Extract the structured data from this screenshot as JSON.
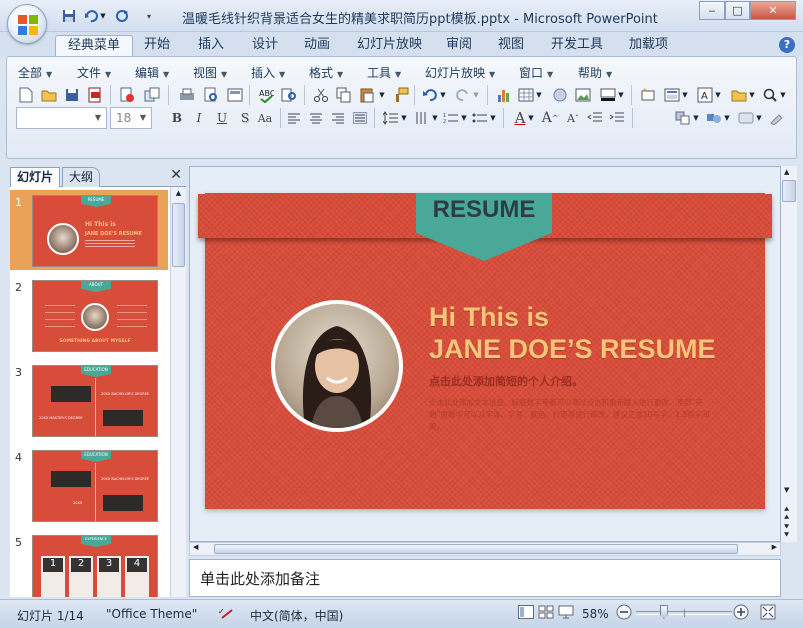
{
  "window": {
    "title": "温暖毛线针织背景适合女生的精美求职简历ppt模板.pptx - Microsoft PowerPoint",
    "minimize": "‒",
    "maximize": "□",
    "close": "✕"
  },
  "ribbon_tabs": [
    "经典菜单",
    "开始",
    "插入",
    "设计",
    "动画",
    "幻灯片放映",
    "审阅",
    "视图",
    "开发工具",
    "加载项"
  ],
  "menu": [
    "全部",
    "文件",
    "编辑",
    "视图",
    "插入",
    "格式",
    "工具",
    "幻灯片放映",
    "窗口",
    "帮助"
  ],
  "font_size": "18",
  "format_buttons": [
    "B",
    "I",
    "U",
    "S",
    "Aa"
  ],
  "pane": {
    "tab_slides": "幻灯片",
    "tab_outline": "大纲",
    "close": "✕"
  },
  "thumbnails": [
    {
      "num": "1",
      "header": "RESUME",
      "line1": "Hi This is",
      "line2": "JANE DOE'S RESUME"
    },
    {
      "num": "2",
      "header": "ABOUT",
      "footer": "SOMETHING ABOUT MYSELF"
    },
    {
      "num": "3",
      "header": "EDUCATION",
      "left": "20XX MASTER'S DEGREE",
      "right": "20XX BACHELOR'S DEGREE"
    },
    {
      "num": "4",
      "header": "EDUCATION",
      "right": "20XX BACHELOR'S DEGREE",
      "left": "20XX"
    },
    {
      "num": "5",
      "header": "EXPERIENCE",
      "cols": [
        "1",
        "2",
        "3",
        "4"
      ]
    }
  ],
  "slide": {
    "tag": "RESUME",
    "hi": "Hi This is",
    "name": "JANE DOE’S RESUME",
    "intro_title": "点击此处添加简短的个人介绍。",
    "intro_body": "点击此处添加文本信息。标题数字等都可以通过点击和重新输入进行更改，顶部“开始”面板中可以对字体、字号、颜色、行距等进行修改。建议正文10号字，1.3倍字间距。",
    "colors": {
      "background": "#da4c3a",
      "tag": "#4aa898",
      "title": "#f5c57a"
    }
  },
  "notes_placeholder": "单击此处添加备注",
  "status": {
    "slide_info": "幻灯片 1/14",
    "theme": "\"Office Theme\"",
    "language": "中文(简体，中国)",
    "zoom": "58%",
    "zoom_level": 0.58
  }
}
